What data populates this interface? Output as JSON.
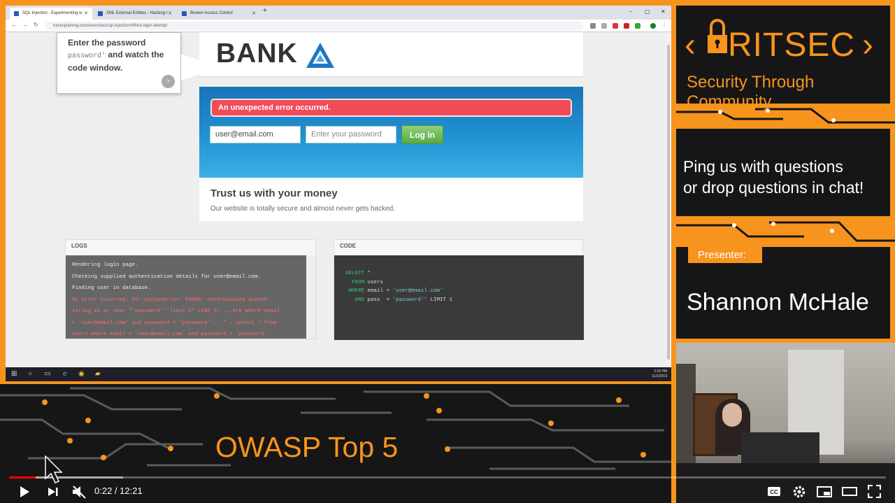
{
  "browser": {
    "tabs": [
      {
        "label": "SQL Injection - Experimenting w",
        "active": true
      },
      {
        "label": "XML External Entities - Hacking t",
        "active": false
      },
      {
        "label": "Broken Access Control",
        "active": false
      }
    ],
    "url": "hacksplaining.com/exercises/sql-injection#/third-login-attempt"
  },
  "callout": {
    "line1": "Enter the password",
    "code": "password'",
    "line2": " and watch the code window."
  },
  "bank": {
    "logo": "BANK",
    "error": "An unexpected error occurred.",
    "email_value": "user@email.com",
    "password_placeholder": "Enter your password",
    "login_label": "Log in",
    "trust_title": "Trust us with your money",
    "trust_sub": "Our website is totally secure and almost never gets hacked."
  },
  "logs": {
    "header": "LOGS",
    "lines": [
      {
        "text": "Rendering login page.",
        "error": false
      },
      {
        "text": "Checking supplied authentication details for user@email.com.",
        "error": false
      },
      {
        "text": "Finding user in database.",
        "error": false
      },
      {
        "text": "An error occurred: PG::SyntaxError: ERROR: unterminated quoted",
        "error": true
      },
      {
        "text": "string at or near \"'password'' limit 1\" LINE 1: ...ere where email",
        "error": true
      },
      {
        "text": "= 'user@email.com' and password = 'password'... \" : select * from",
        "error": true
      },
      {
        "text": "users where email = 'user@email.com' and password = 'password'",
        "error": true
      }
    ]
  },
  "code": {
    "header": "CODE",
    "lines": [
      {
        "kw": "SELECT",
        "rest": " *",
        "str": "",
        "tail": ""
      },
      {
        "kw": "  FROM",
        "rest": " users",
        "str": "",
        "tail": ""
      },
      {
        "kw": " WHERE",
        "rest": " email = ",
        "str": "'user@email.com'",
        "tail": ""
      },
      {
        "kw": "   AND",
        "rest": " pass  = ",
        "str": "'password''",
        "tail": " LIMIT 1"
      }
    ]
  },
  "taskbar": {
    "clock_time": "2:20 PM",
    "clock_date": "11/1/2019"
  },
  "branding": {
    "ritsec": "RITSEC",
    "tagline": "Security Through Community",
    "ping_line1": "Ping us with questions",
    "ping_line2": "or drop questions in chat!",
    "presenter_label": "Presenter:",
    "presenter_name": "Shannon McHale",
    "talk_title": "OWASP Top 5",
    "accent": "#f7941d"
  },
  "player": {
    "time": "0:22 / 12:21",
    "progress_fraction": 0.03,
    "buffered_fraction": 0.13
  }
}
